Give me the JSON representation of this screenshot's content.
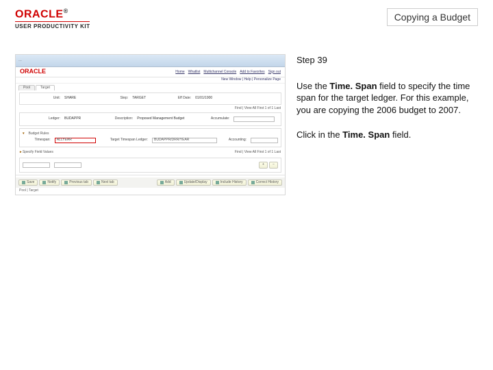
{
  "brand": {
    "name": "ORACLE",
    "subline": "USER PRODUCTIVITY KIT"
  },
  "page_title": "Copying a Budget",
  "step": {
    "label": "Step 39",
    "para1_pre": "Use the ",
    "para1_b1": "Time. Span",
    "para1_mid": " field to specify the time span for the target ledger. For this example, you are copying the 2006 budget to 2007.",
    "para2_pre": "Click in the ",
    "para2_b1": "Time. Span",
    "para2_post": " field."
  },
  "shot": {
    "breadcrumb": "…",
    "brandLinks": [
      "Home",
      "Whatlist",
      "Multichannel Console",
      "Add to Favorites",
      "Sign out"
    ],
    "subhead": "New Window | Help | Personalize Page",
    "tabs": [
      "Pool",
      "Target"
    ],
    "sec1": {
      "unit_l": "Unit:",
      "unit_v": "SHARE",
      "step_l": "Step:",
      "step_v": "TARGET",
      "effdt_l": "Eff Date:",
      "effdt_v": "01/01/1900"
    },
    "gridHint": "Find | View All   First 1 of 1 Last",
    "sec2": {
      "ledger_l": "Ledger:",
      "ledger_v": "BUDAPPR",
      "descr_l": "Description:",
      "descr_v": "Proposed Management Budget",
      "accum_l": "Accumulate:"
    },
    "targetHead": "Budget Rules",
    "sec3": {
      "ts_l": "Timespan:",
      "ts_v": "ALLYEAR",
      "ttl_l": "Target Timespan Ledger:",
      "ttl_v": "BUDAPPR/DRR/YEAR",
      "acct_l": "Accounting:"
    },
    "specHead": "Specify Field Values",
    "specGridHint": "Find | View All   First 1 of 1 Last",
    "btns": [
      "Save",
      "Notify",
      "Previous tab",
      "Next tab",
      "Add",
      "Update/Display",
      "Include History",
      "Correct History"
    ],
    "foot": "Pool | Target"
  }
}
